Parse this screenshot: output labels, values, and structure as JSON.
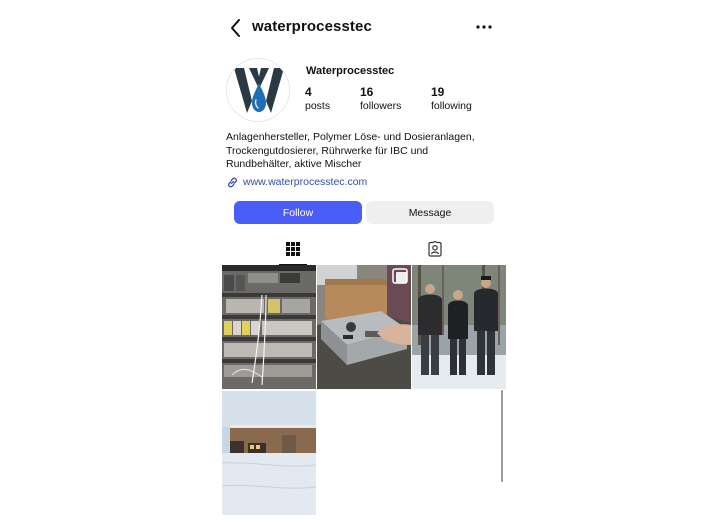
{
  "header": {
    "username": "waterprocesstec",
    "back_icon": "chevron-left-icon",
    "more_icon": "more-horizontal-icon"
  },
  "profile": {
    "name": "Waterprocesstec",
    "stats": [
      {
        "value": "4",
        "label": "posts"
      },
      {
        "value": "16",
        "label": "followers"
      },
      {
        "value": "19",
        "label": "following"
      }
    ],
    "bio_lines": [
      "Anlagenhersteller, Polymer Löse- und Dosieranlagen,",
      "Trockengutdosierer, Rührwerke für IBC und",
      "Rundbehälter, aktive Mischer"
    ],
    "link": "www.waterprocesstec.com",
    "link_icon": "link-icon"
  },
  "actions": {
    "follow_label": "Follow",
    "message_label": "Message"
  },
  "tabs": [
    {
      "icon": "grid-icon",
      "active": true
    },
    {
      "icon": "tagged-person-icon",
      "active": false
    }
  ],
  "posts": [
    {
      "subject": "electrical control cabinet with circuit breakers and wiring"
    },
    {
      "subject": "hands assembling a steel dosing unit next to a cardboard box",
      "badge_icon": "multiple-photos-icon"
    },
    {
      "subject": "three men standing in a snowy forest"
    },
    {
      "subject": "industrial building with wooden facade in snow"
    }
  ],
  "colors": {
    "follow_button": "#4a5df9",
    "message_button": "#efefef",
    "link": "#2d4fa8",
    "logo_dark": "#2a3a44",
    "logo_drop": "#1c6fb5"
  }
}
